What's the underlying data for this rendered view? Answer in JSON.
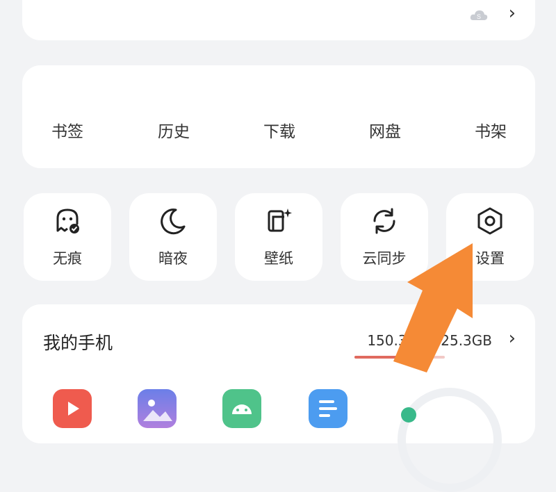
{
  "top_card": {
    "cloud_icon": "cloud-sync-icon",
    "chevron": "›"
  },
  "nav": {
    "items": [
      {
        "label": "书签"
      },
      {
        "label": "历史"
      },
      {
        "label": "下载"
      },
      {
        "label": "网盘"
      },
      {
        "label": "书架"
      }
    ]
  },
  "tools": [
    {
      "label": "无痕",
      "icon": "incognito-ghost-icon"
    },
    {
      "label": "暗夜",
      "icon": "moon-icon"
    },
    {
      "label": "壁纸",
      "icon": "wallpaper-icon"
    },
    {
      "label": "云同步",
      "icon": "sync-icon"
    },
    {
      "label": "设置",
      "icon": "settings-hexagon-icon"
    }
  ],
  "phone": {
    "title": "我的手机",
    "storage_text": "150.3GB/225.3GB",
    "storage_used_fraction": 0.667,
    "chevron": "›",
    "apps": [
      "video-app-icon",
      "gallery-app-icon",
      "android-app-icon",
      "document-app-icon"
    ]
  },
  "colors": {
    "accent_arrow": "#f58a36",
    "storage_fill": "#e06a5f"
  }
}
